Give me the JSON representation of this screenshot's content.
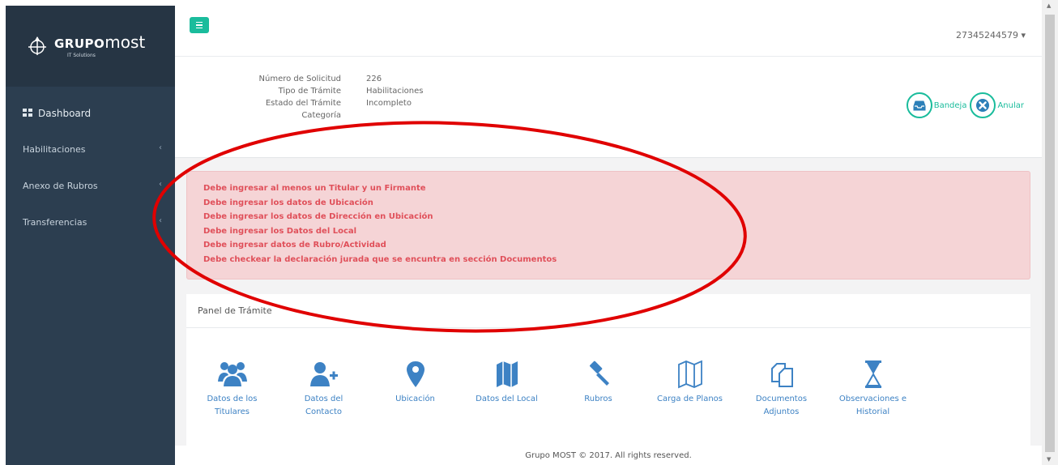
{
  "brand": {
    "name_bold": "GRUPO",
    "name_thin": "most",
    "subtitle": "IT Solutions"
  },
  "sidebar": {
    "items": [
      {
        "label": "Dashboard"
      },
      {
        "label": "Habilitaciones",
        "chevron": "‹"
      },
      {
        "label": "Anexo de Rubros",
        "chevron": "‹"
      },
      {
        "label": "Transferencias",
        "chevron": "‹"
      }
    ]
  },
  "header": {
    "user": "27345244579 ▾"
  },
  "solicitud": {
    "labels": [
      "Número de Solicitud",
      "Tipo de Trámite",
      "Estado del Trámite",
      "Categoría"
    ],
    "values": [
      "226",
      "Habilitaciones",
      "Incompleto",
      ""
    ]
  },
  "actions": {
    "bandeja": "Bandeja",
    "anular": "Anular"
  },
  "alert": {
    "messages": [
      "Debe ingresar al menos un Titular y un Firmante",
      "Debe ingresar los datos de Ubicación",
      "Debe ingresar los datos de Dirección en Ubicación",
      "Debe ingresar los Datos del Local",
      "Debe ingresar datos de Rubro/Actividad",
      "Debe checkear la declaración jurada que se encuntra en sección Documentos"
    ]
  },
  "panel": {
    "title": "Panel de Trámite",
    "tiles": [
      {
        "label": "Datos de los Titulares",
        "icon": "users-icon"
      },
      {
        "label": "Datos del Contacto",
        "icon": "user-plus-icon"
      },
      {
        "label": "Ubicación",
        "icon": "map-marker-icon"
      },
      {
        "label": "Datos del Local",
        "icon": "map-icon"
      },
      {
        "label": "Rubros",
        "icon": "gavel-icon"
      },
      {
        "label": "Carga de Planos",
        "icon": "map-outline-icon"
      },
      {
        "label": "Documentos Adjuntos",
        "icon": "files-icon"
      },
      {
        "label": "Observaciones e Historial",
        "icon": "hourglass-icon"
      }
    ]
  },
  "footer": {
    "text": "Grupo MOST © 2017. All rights reserved."
  },
  "colors": {
    "sidebar": "#2c3e50",
    "accent": "#1abc9c",
    "alert_bg": "#f5d4d6",
    "alert_text": "#e0505a",
    "link": "#3d82c4",
    "annotation": "#e00000"
  }
}
